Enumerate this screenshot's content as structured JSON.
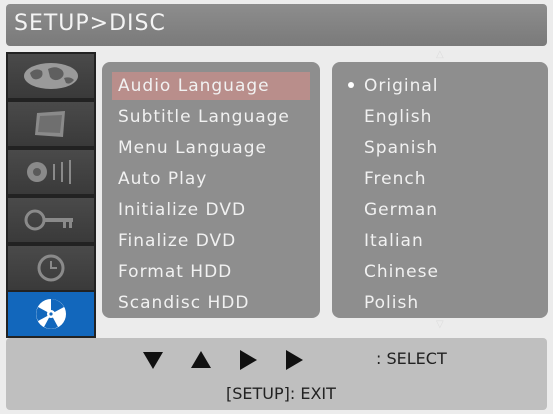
{
  "header": {
    "title": "SETUP>DISC"
  },
  "sidebar": {
    "items": [
      {
        "icon": "globe-icon"
      },
      {
        "icon": "tv-screen-icon"
      },
      {
        "icon": "speaker-icon"
      },
      {
        "icon": "key-icon"
      },
      {
        "icon": "clock-icon"
      },
      {
        "icon": "disc-icon",
        "active": true
      }
    ]
  },
  "menu": {
    "items": [
      "Audio Language",
      "Subtitle Language",
      "Menu Language",
      "Auto Play",
      "Initialize DVD",
      "Finalize DVD",
      "Format HDD",
      "Scandisc HDD"
    ],
    "selected": "Audio Language"
  },
  "options": {
    "items": [
      "Original",
      "English",
      "Spanish",
      "French",
      "German",
      "Italian",
      "Chinese",
      "Polish"
    ],
    "selected": "Original"
  },
  "footer": {
    "select_label": ": SELECT",
    "exit_label": "[SETUP]: EXIT"
  },
  "colors": {
    "header": "#808080",
    "panel": "#8e8e8e",
    "highlight": "#b98e8b",
    "active_tab": "#1267bc"
  }
}
